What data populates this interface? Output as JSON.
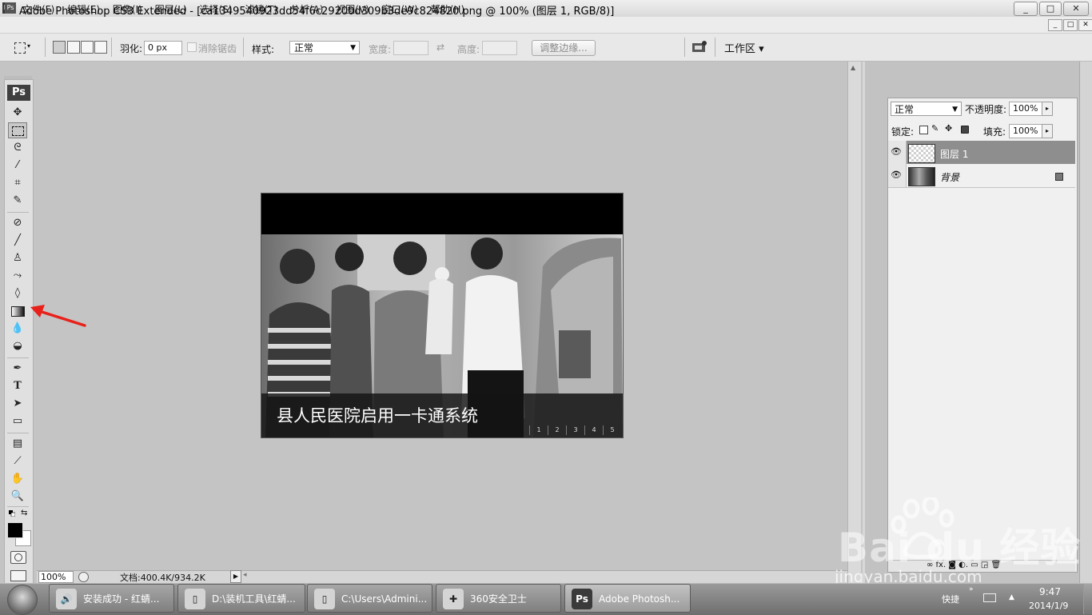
{
  "window": {
    "app_icon": "Ps",
    "title": "Adobe Photoshop CS3 Extended - [ca1349540923dd54f6c29200d309b3de9c824820.png @ 100% (图层 1, RGB/8)]",
    "controls": [
      "_",
      "□",
      "✕"
    ]
  },
  "menubar": {
    "items": [
      "文件(F)",
      "编辑(E)",
      "图像(I)",
      "图层(L)",
      "选择(S)",
      "滤镜(T)",
      "分析(A)",
      "视图(V)",
      "窗口(W)",
      "帮助(H)"
    ],
    "doc_controls": [
      "_",
      "□",
      "✕"
    ]
  },
  "options": {
    "feather_label": "羽化:",
    "feather_value": "0 px",
    "antialias_label": "消除锯齿",
    "style_label": "样式:",
    "style_value": "正常",
    "width_label": "宽度:",
    "height_label": "高度:",
    "swap_symbol": "⇄",
    "refine_edge": "调整边缘...",
    "workspace": "工作区 ▾"
  },
  "toolbox": {
    "logo": "Ps",
    "tools": [
      "move-tool",
      "marquee-tool",
      "lasso-tool",
      "magic-wand-tool",
      "crop-tool",
      "slice-tool",
      "healing-brush-tool",
      "brush-tool",
      "clone-stamp-tool",
      "history-brush-tool",
      "eraser-tool",
      "gradient-tool",
      "blur-tool",
      "dodge-tool",
      "pen-tool",
      "type-tool",
      "path-selection-tool",
      "rectangle-tool",
      "notes-tool",
      "eyedropper-tool",
      "hand-tool",
      "zoom-tool"
    ],
    "foreground_color": "#000000",
    "background_color": "#ffffff"
  },
  "canvas": {
    "caption": "县人民医院启用一卡通系统",
    "pager": [
      "1",
      "2",
      "3",
      "4",
      "5"
    ]
  },
  "status": {
    "zoom": "100%",
    "doc_size": "文档:400.4K/934.2K"
  },
  "layers_panel": {
    "blend_mode": "正常",
    "opacity_label": "不透明度:",
    "opacity_value": "100%",
    "lock_label": "锁定:",
    "fill_label": "填充:",
    "fill_value": "100%",
    "layers": [
      {
        "name": "图层 1",
        "selected": true
      },
      {
        "name": "背景",
        "selected": false,
        "locked": true
      }
    ],
    "footer_icons": "∞  fx.  ◙  ◐.  ▭  ◲  🗑"
  },
  "watermark": {
    "brand": "Bai du 经验",
    "url": "jingyan.baidu.com"
  },
  "taskbar": {
    "tasks": [
      {
        "icon": "🔊",
        "label": "安装成功 - 红蜻..."
      },
      {
        "icon": "▯",
        "label": "D:\\装机工具\\红蜻..."
      },
      {
        "icon": "▯",
        "label": "C:\\Users\\Admini..."
      },
      {
        "icon": "✚",
        "label": "360安全卫士"
      },
      {
        "icon": "Ps",
        "label": "Adobe Photosh..."
      }
    ],
    "tray": "快捷",
    "time": "9:47",
    "date": "2014/1/9"
  },
  "annotation": {
    "color": "#e8211a"
  }
}
